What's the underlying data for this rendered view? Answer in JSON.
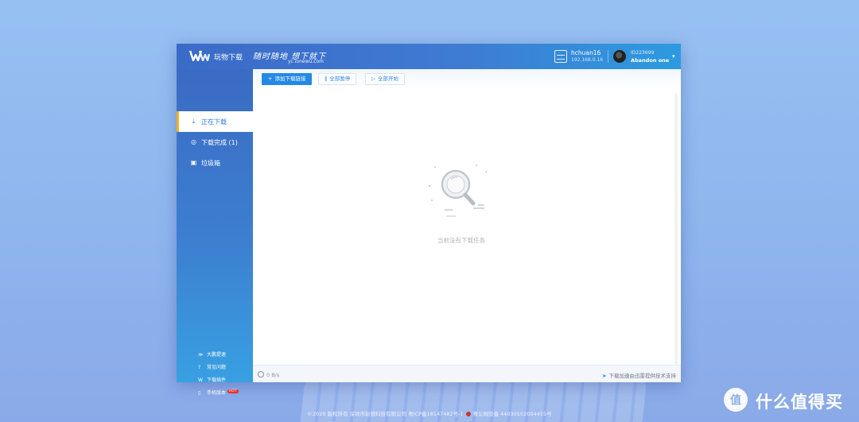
{
  "app": {
    "name": "玩物下载",
    "slogan": "随时随地 想下就下",
    "url": "yc.ionewu.com"
  },
  "device": {
    "name": "hchuan16",
    "ip": "192.168.0.16"
  },
  "user": {
    "id": "ID223699",
    "name": "Abandon one"
  },
  "sidebar": {
    "items": [
      {
        "label": "正在下载",
        "icon": "download-icon"
      },
      {
        "label": "下载完成 (1)",
        "icon": "check-circle-icon"
      },
      {
        "label": "垃圾箱",
        "icon": "trash-icon"
      }
    ],
    "footer_links": [
      {
        "label": "大鹏提速",
        "icon": "speed-icon"
      },
      {
        "label": "常见问题",
        "icon": "question-icon"
      },
      {
        "label": "下载插件",
        "icon": "logo-icon"
      },
      {
        "label": "手机版本",
        "icon": "phone-icon",
        "badge": "HOT"
      }
    ]
  },
  "toolbar": {
    "add_label": "添加下载链接",
    "pause_all_label": "全部暂停",
    "start_all_label": "全部开始"
  },
  "main": {
    "empty_text": "当前没有下载任务"
  },
  "statusbar": {
    "speed": "0 B/s",
    "powered": "下载加速由迅雷提供技术支持"
  },
  "footer": {
    "text": "©2020 版权所有 深圳市玩物科技有限公司 粤ICP备18147482号-1",
    "police": "粤公网安备 44030502004455号"
  },
  "watermark": {
    "text": "什么值得买"
  },
  "colors": {
    "accent": "#2389e7",
    "active_marker": "#f1b21e",
    "hot": "#e5322d"
  }
}
